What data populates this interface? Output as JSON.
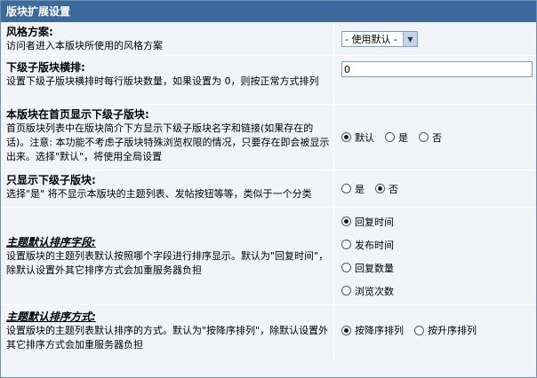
{
  "header": {
    "title": "版块扩展设置"
  },
  "style_scheme": {
    "title": "风格方案:",
    "desc": "访问者进入本版块所使用的风格方案",
    "select_value": "- 使用默认 -"
  },
  "sub_forum_columns": {
    "title": "下级子版块横排:",
    "desc": "设置下级子版块横排时每行版块数量，如果设置为 0，则按正常方式排列",
    "value": "0"
  },
  "show_sub_on_home": {
    "title": "本版块在首页显示下级子版块:",
    "desc": "首页版块列表中在版块简介下方显示下级子版块名字和链接(如果存在的话)。注意: 本功能不考虑子版块特殊浏览权限的情况，只要存在即会被显示出来。选择\"默认\"，将使用全局设置",
    "options": [
      "默认",
      "是",
      "否"
    ],
    "selected": "默认"
  },
  "only_show_sub": {
    "title": "只显示下级子版块:",
    "desc": "选择\"是\" 将不显示本版块的主题列表、发帖按钮等等，类似于一个分类",
    "options": [
      "是",
      "否"
    ],
    "selected": "否"
  },
  "default_sort_field": {
    "title": "主题默认排序字段:",
    "desc": "设置版块的主题列表默认按照哪个字段进行排序显示。默认为\"回复时间\"，除默认设置外其它排序方式会加重服务器负担",
    "options": [
      "回复时间",
      "发布时间",
      "回复数量",
      "浏览次数"
    ],
    "selected": "回复时间"
  },
  "default_sort_order": {
    "title": "主题默认排序方式:",
    "desc": "设置版块的主题列表默认排序的方式。默认为\"按降序排列\"，除默认设置外其它排序方式会加重服务器负担",
    "options": [
      "按降序排列",
      "按升序排列"
    ],
    "selected": "按降序排列"
  }
}
